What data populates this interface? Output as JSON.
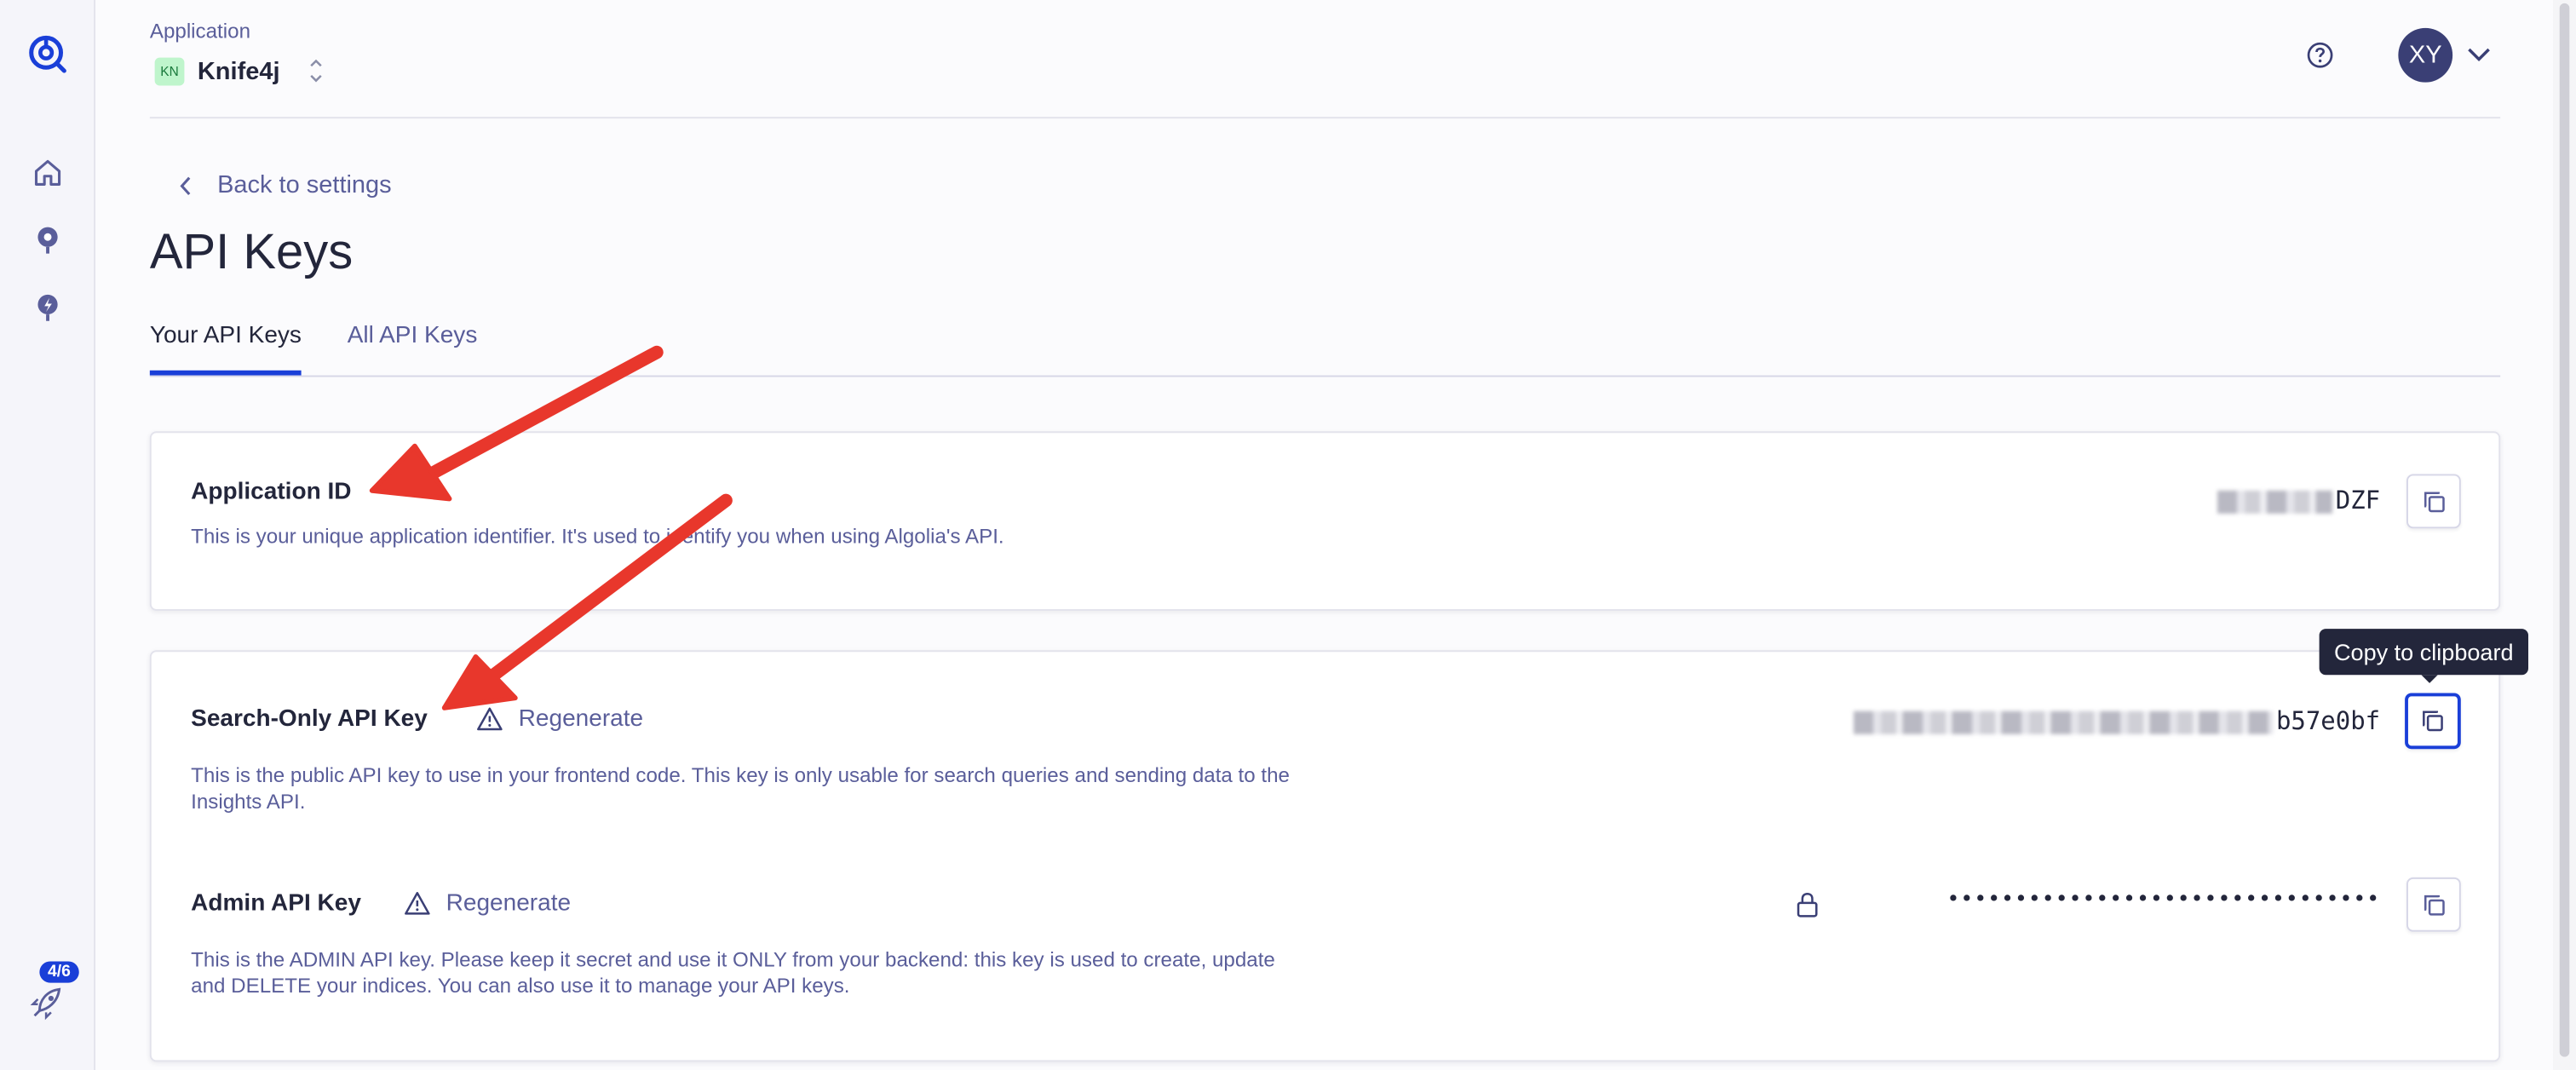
{
  "header": {
    "app_label": "Application",
    "app_badge": "KN",
    "app_name": "Knife4j",
    "avatar_initials": "XY"
  },
  "sidebar": {
    "onboarding_badge": "4/6",
    "items": [
      {
        "icon": "algolia-logo-icon"
      },
      {
        "icon": "home-icon"
      },
      {
        "icon": "search-pin-icon"
      },
      {
        "icon": "lightning-pin-icon"
      },
      {
        "icon": "rocket-icon"
      }
    ]
  },
  "nav": {
    "back_label": "Back to settings"
  },
  "page": {
    "title": "API Keys"
  },
  "tabs": [
    {
      "label": "Your API Keys",
      "active": true
    },
    {
      "label": "All API Keys",
      "active": false
    }
  ],
  "keys": {
    "application_id": {
      "title": "Application ID",
      "description": "This is your unique application identifier. It's used to identify you when using Algolia's API.",
      "value_suffix": "DZF"
    },
    "search_only": {
      "title": "Search-Only API Key",
      "regenerate_label": "Regenerate",
      "description": "This is the public API key to use in your frontend code. This key is only usable for search queries and sending data to the Insights API.",
      "value_suffix": "b57e0bf"
    },
    "admin": {
      "title": "Admin API Key",
      "regenerate_label": "Regenerate",
      "description": "This is the ADMIN API key. Please keep it secret and use it ONLY from your backend: this key is used to create, update and DELETE your indices. You can also use it to manage your API keys.",
      "masked_value": "••••••••••••••••••••••••••••••••"
    }
  },
  "tooltip": {
    "text": "Copy to clipboard"
  },
  "colors": {
    "accent": "#1a3fd8",
    "annotation_arrow": "#e8372c",
    "text_primary": "#23263b",
    "text_secondary": "#5a5e9a"
  }
}
